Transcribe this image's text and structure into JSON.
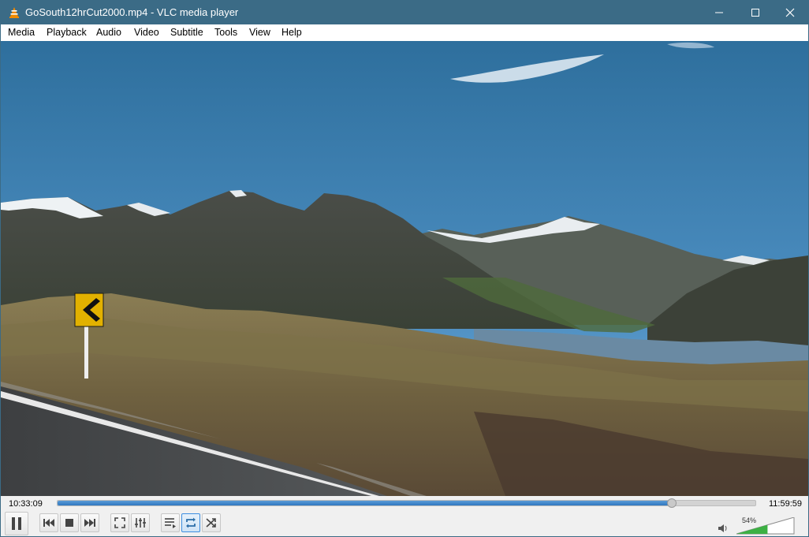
{
  "window": {
    "title": "GoSouth12hrCut2000.mp4 - VLC media player"
  },
  "menu": {
    "items": [
      {
        "label": "Media"
      },
      {
        "label": "Playback"
      },
      {
        "label": "Audio"
      },
      {
        "label": "Video"
      },
      {
        "label": "Subtitle"
      },
      {
        "label": "Tools"
      },
      {
        "label": "View"
      },
      {
        "label": "Help"
      }
    ]
  },
  "playback": {
    "elapsed": "10:33:09",
    "total": "11:59:59",
    "progress": 0.88
  },
  "volume": {
    "label": "54%",
    "level": 0.54
  },
  "controls": {
    "loop_active": true
  },
  "colors": {
    "titlebar": "#3b6b86",
    "seek_fill": "#2f78c0",
    "volume_fill": "#3cb043",
    "vlc_orange": "#f08a00"
  },
  "icons": {
    "app": "vlc-cone-icon",
    "minimize": "minimize-icon",
    "maximize": "maximize-icon",
    "close": "close-icon",
    "pause": "pause-icon",
    "previous": "previous-icon",
    "stop": "stop-icon",
    "next": "next-icon",
    "fullscreen": "fullscreen-icon",
    "extended": "equalizer-icon",
    "playlist": "playlist-icon",
    "loop": "loop-icon",
    "shuffle": "shuffle-icon",
    "speaker": "speaker-icon"
  }
}
